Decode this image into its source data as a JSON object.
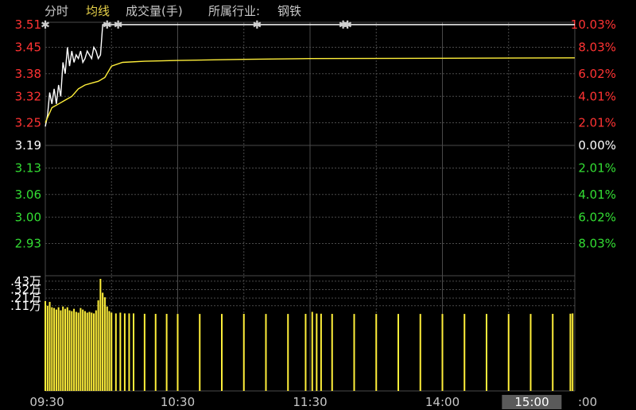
{
  "legend": {
    "time_share": "分时",
    "average_line": "均线",
    "volume": "成交量(手)",
    "industry_label": "所属行业:",
    "industry_value": "钢铁"
  },
  "colors": {
    "background": "#000000",
    "grid": "#4a4a4a",
    "up": "#ff3333",
    "down": "#33dd33",
    "neutral": "#ffffff",
    "price_line": "#ffffff",
    "avg_line": "#ffef3a",
    "volume_bar": "#ffef3a",
    "marker": "#cfcfcf"
  },
  "chart_data": {
    "type": "line",
    "price_axis": {
      "ylim": [
        2.87,
        3.51
      ],
      "prev_close": 3.19,
      "ticks": [
        "3.51",
        "3.45",
        "3.38",
        "3.32",
        "3.25",
        "3.19",
        "3.13",
        "3.06",
        "3.00",
        "2.93"
      ],
      "tick_values": [
        3.51,
        3.45,
        3.38,
        3.32,
        3.25,
        3.19,
        3.13,
        3.06,
        3.0,
        2.93
      ]
    },
    "pct_axis": {
      "ticks": [
        "10.03%",
        "8.03%",
        "6.02%",
        "4.01%",
        "2.01%",
        "0.00%",
        "2.01%",
        "4.01%",
        "6.02%",
        "8.03%"
      ],
      "tick_values": [
        3.51,
        3.45,
        3.38,
        3.32,
        3.25,
        3.19,
        3.13,
        3.06,
        3.0,
        2.93
      ]
    },
    "time_axis": {
      "ticks": [
        "09:30",
        "10:30",
        "11:30",
        "14:00",
        "15:00"
      ],
      "tick_minutes": [
        0,
        60,
        120,
        180,
        240
      ],
      "cut_label": ":00",
      "highlight": "15:00"
    },
    "volume_axis": {
      "ylim": [
        0,
        1.47
      ],
      "ticks": [
        ".43万",
        ".32万",
        ".21万",
        ".11万"
      ],
      "tick_values": [
        1.43,
        1.32,
        1.21,
        1.11
      ]
    },
    "series": [
      {
        "name": "分时",
        "x": [
          0,
          1,
          2,
          3,
          4,
          5,
          6,
          7,
          8,
          9,
          10,
          11,
          12,
          13,
          14,
          15,
          16,
          17,
          18,
          19,
          20,
          21,
          22,
          23,
          24,
          25,
          26,
          27,
          240
        ],
        "y": [
          3.24,
          3.27,
          3.33,
          3.3,
          3.34,
          3.3,
          3.35,
          3.32,
          3.41,
          3.38,
          3.45,
          3.4,
          3.44,
          3.41,
          3.43,
          3.42,
          3.44,
          3.41,
          3.42,
          3.44,
          3.43,
          3.42,
          3.45,
          3.44,
          3.42,
          3.43,
          3.51,
          3.51,
          3.51
        ]
      },
      {
        "name": "均线",
        "x": [
          0,
          3,
          6,
          9,
          12,
          15,
          18,
          21,
          24,
          27,
          30,
          35,
          45,
          60,
          90,
          120,
          180,
          240
        ],
        "y": [
          3.25,
          3.29,
          3.3,
          3.31,
          3.32,
          3.34,
          3.35,
          3.355,
          3.36,
          3.37,
          3.4,
          3.41,
          3.413,
          3.415,
          3.418,
          3.42,
          3.421,
          3.422
        ]
      }
    ],
    "limit_up_markers": [
      0,
      28,
      33,
      96,
      135,
      137
    ],
    "volume": [
      [
        0,
        1.17
      ],
      [
        1,
        1.11
      ],
      [
        2,
        1.16
      ],
      [
        3,
        1.09
      ],
      [
        4,
        1.08
      ],
      [
        5,
        1.06
      ],
      [
        6,
        1.09
      ],
      [
        7,
        1.05
      ],
      [
        8,
        1.1
      ],
      [
        9,
        1.07
      ],
      [
        10,
        1.09
      ],
      [
        11,
        1.05
      ],
      [
        12,
        1.04
      ],
      [
        13,
        1.07
      ],
      [
        14,
        1.03
      ],
      [
        15,
        1.02
      ],
      [
        16,
        1.08
      ],
      [
        17,
        1.06
      ],
      [
        18,
        1.04
      ],
      [
        19,
        1.02
      ],
      [
        20,
        1.03
      ],
      [
        21,
        1.02
      ],
      [
        22,
        1.01
      ],
      [
        23,
        1.05
      ],
      [
        24,
        1.18
      ],
      [
        25,
        1.46
      ],
      [
        26,
        1.28
      ],
      [
        27,
        1.22
      ],
      [
        28,
        1.1
      ],
      [
        29,
        1.04
      ],
      [
        30,
        1.02
      ],
      [
        32,
        1.01
      ],
      [
        34,
        1.02
      ],
      [
        36,
        1.01
      ],
      [
        38,
        1.01
      ],
      [
        40,
        1.01
      ],
      [
        45,
        1.005
      ],
      [
        50,
        1.004
      ],
      [
        55,
        1.004
      ],
      [
        60,
        1.003
      ],
      [
        70,
        1.003
      ],
      [
        80,
        1.003
      ],
      [
        90,
        1.004
      ],
      [
        100,
        1.003
      ],
      [
        110,
        1.003
      ],
      [
        118,
        1.004
      ],
      [
        121,
        1.03
      ],
      [
        123,
        1.008
      ],
      [
        125,
        1.006
      ],
      [
        130,
        1.004
      ],
      [
        140,
        1.003
      ],
      [
        150,
        1.003
      ],
      [
        160,
        1.003
      ],
      [
        170,
        1.003
      ],
      [
        180,
        1.003
      ],
      [
        190,
        1.003
      ],
      [
        200,
        1.003
      ],
      [
        210,
        1.003
      ],
      [
        220,
        1.003
      ],
      [
        230,
        1.004
      ],
      [
        238,
        1.006
      ],
      [
        239,
        1.01
      ]
    ]
  }
}
